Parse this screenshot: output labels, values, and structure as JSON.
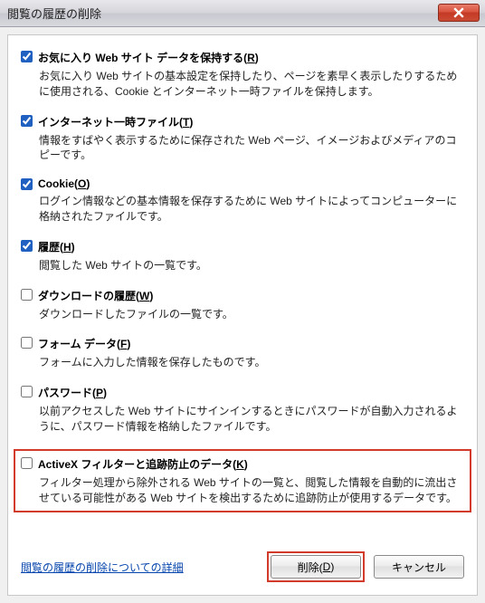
{
  "window": {
    "title": "閲覧の履歴の削除"
  },
  "options": {
    "fav": {
      "checked": true,
      "label_pre": "お気に入り Web サイト データを保持する(",
      "label_u": "R",
      "label_post": ")",
      "desc": "お気に入り Web サイトの基本設定を保持したり、ページを素早く表示したりするために使用される、Cookie とインターネット一時ファイルを保持します。"
    },
    "temp": {
      "checked": true,
      "label_pre": "インターネット一時ファイル(",
      "label_u": "T",
      "label_post": ")",
      "desc": "情報をすばやく表示するために保存された Web ページ、イメージおよびメディアのコピーです。"
    },
    "cookie": {
      "checked": true,
      "label_pre": "Cookie(",
      "label_u": "O",
      "label_post": ")",
      "desc": "ログイン情報などの基本情報を保存するために Web サイトによってコンピューターに格納されたファイルです。"
    },
    "history": {
      "checked": true,
      "label_pre": "履歴(",
      "label_u": "H",
      "label_post": ")",
      "desc": "閲覧した Web サイトの一覧です。"
    },
    "download": {
      "checked": false,
      "label_pre": "ダウンロードの履歴(",
      "label_u": "W",
      "label_post": ")",
      "desc": "ダウンロードしたファイルの一覧です。"
    },
    "form": {
      "checked": false,
      "label_pre": "フォーム データ(",
      "label_u": "F",
      "label_post": ")",
      "desc": "フォームに入力した情報を保存したものです。"
    },
    "password": {
      "checked": false,
      "label_pre": "パスワード(",
      "label_u": "P",
      "label_post": ")",
      "desc": "以前アクセスした Web サイトにサインインするときにパスワードが自動入力されるように、パスワード情報を格納したファイルです。"
    },
    "activex": {
      "checked": false,
      "label_pre": "ActiveX フィルターと追跡防止のデータ(",
      "label_u": "K",
      "label_post": ")",
      "desc": "フィルター処理から除外される Web サイトの一覧と、閲覧した情報を自動的に流出させている可能性がある Web サイトを検出するために追跡防止が使用するデータです。"
    }
  },
  "footer": {
    "link": "閲覧の履歴の削除についての詳細",
    "delete_pre": "削除(",
    "delete_u": "D",
    "delete_post": ")",
    "cancel": "キャンセル"
  }
}
